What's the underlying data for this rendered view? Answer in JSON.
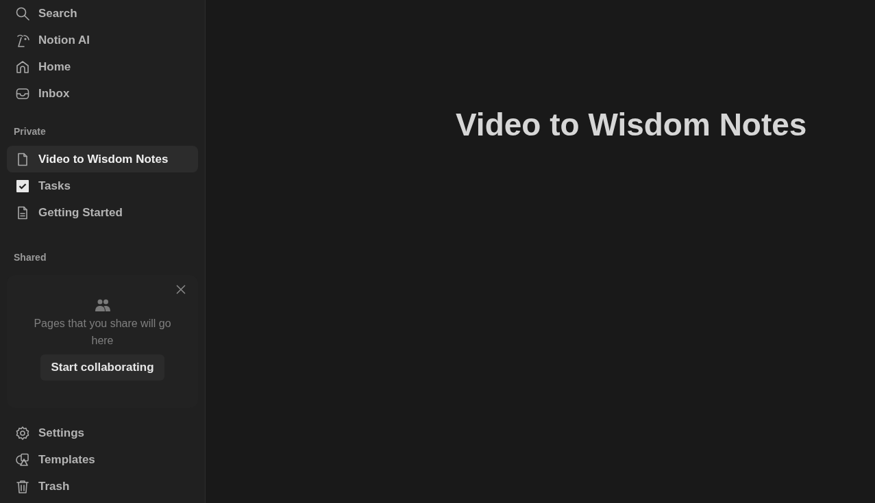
{
  "sidebar": {
    "top_items": [
      {
        "label": "Search"
      },
      {
        "label": "Notion AI"
      },
      {
        "label": "Home"
      },
      {
        "label": "Inbox"
      }
    ],
    "private": {
      "heading": "Private",
      "pages": [
        {
          "label": "Video to Wisdom Notes",
          "selected": true
        },
        {
          "label": "Tasks",
          "selected": false
        },
        {
          "label": "Getting Started",
          "selected": false
        }
      ]
    },
    "shared": {
      "heading": "Shared",
      "card": {
        "message": "Pages that you share will go here",
        "button": "Start collaborating"
      }
    },
    "bottom_items": [
      {
        "label": "Settings"
      },
      {
        "label": "Templates"
      },
      {
        "label": "Trash"
      }
    ]
  },
  "page": {
    "title": "Video to Wisdom Notes"
  }
}
